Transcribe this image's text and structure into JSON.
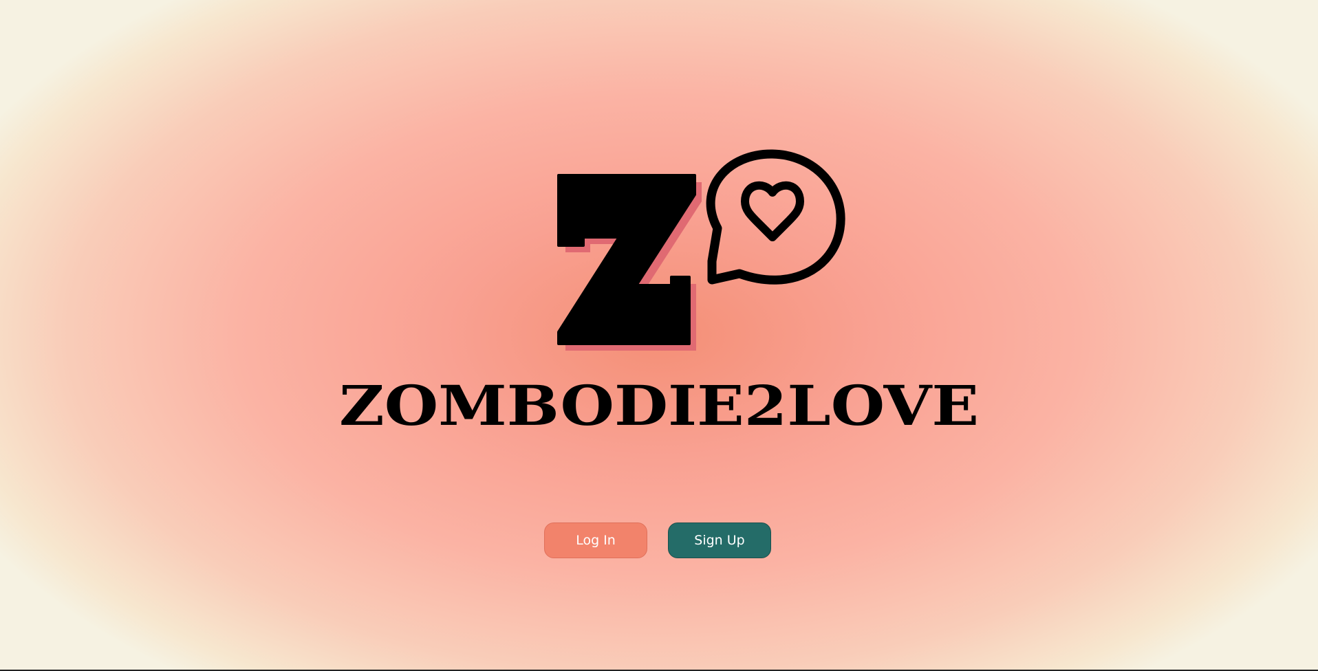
{
  "brand": {
    "name": "ZOMBODIE2LOVE",
    "logo_icon": "z-heart-speech-bubble-icon",
    "colors": {
      "text": "#000000",
      "shadow": "#e06a72",
      "background_center": "#f48f76",
      "background_edge": "#f6f2e2"
    }
  },
  "actions": {
    "login_label": "Log In",
    "signup_label": "Sign Up",
    "login_color": "#f2836b",
    "signup_color": "#246c68"
  }
}
